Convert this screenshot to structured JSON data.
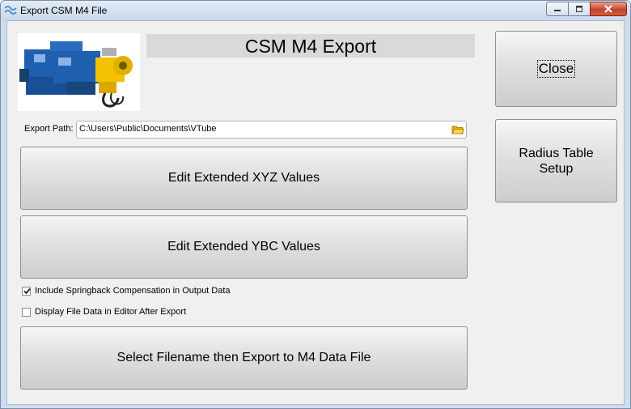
{
  "window": {
    "title": "Export CSM M4 File",
    "icon": "tube-wave-icon"
  },
  "header": {
    "title": "CSM M4 Export",
    "image": "tube-bender-machine-photo"
  },
  "export_path": {
    "label": "Export Path:",
    "value": "C:\\Users\\Public\\Documents\\VTube",
    "icon": "folder-open-icon"
  },
  "buttons": {
    "edit_xyz": "Edit Extended XYZ Values",
    "edit_ybc": "Edit Extended YBC Values",
    "export": "Select Filename then Export to M4 Data File",
    "close": "Close",
    "radius_line1": "Radius Table",
    "radius_line2": "Setup"
  },
  "options": [
    {
      "label": "Include Springback Compensation in Output Data",
      "checked": true
    },
    {
      "label": "Display File Data in Editor After Export",
      "checked": false
    }
  ],
  "colors": {
    "titlebar": "#c9d8ea",
    "close_button": "#c7432a",
    "header_band": "#d9d9d9",
    "machine_blue": "#1f5fb0",
    "machine_yellow": "#f2c200"
  }
}
